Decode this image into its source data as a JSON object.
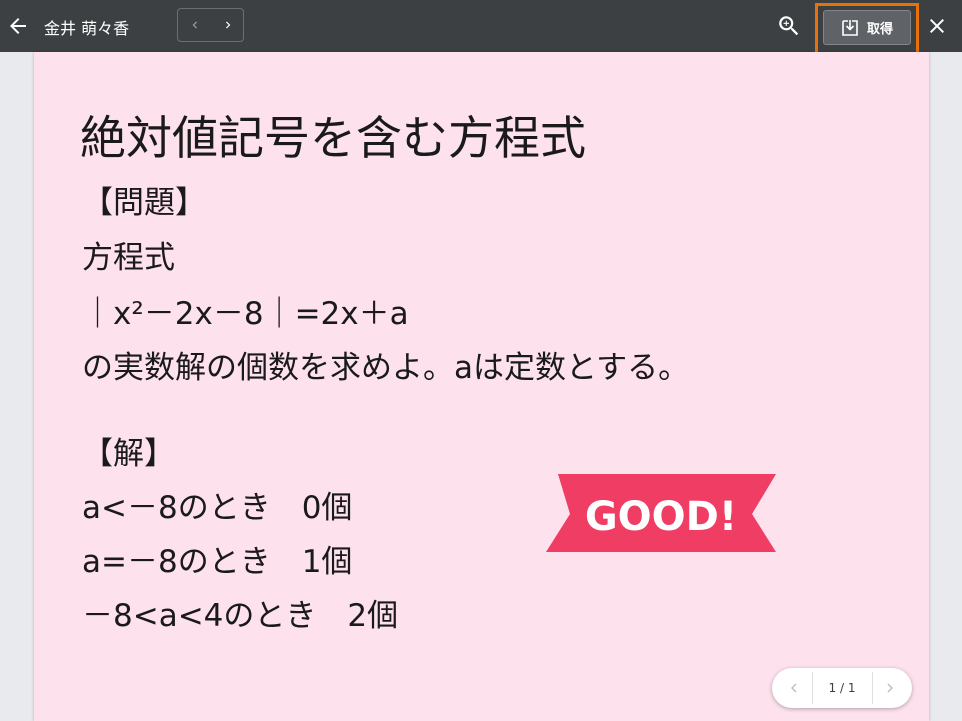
{
  "header": {
    "user_name": "金井 萌々香",
    "get_label": "取得"
  },
  "slide": {
    "title": "絶対値記号を含む方程式",
    "lines": [
      "【問題】",
      "方程式",
      "｜x²－2x－8｜=2x＋a",
      "の実数解の個数を求めよ。aは定数とする。",
      "【解】",
      "a<－8のとき　0個",
      "a=－8のとき　1個",
      "－8<a<4のとき　2個"
    ],
    "stamp_text": "GOOD!"
  },
  "pager": {
    "label": "1 / 1"
  },
  "colors": {
    "topbar": "#3c4043",
    "slide_bg": "#fde2ee",
    "stamp": "#ef3d63",
    "highlight": "#e8710a"
  },
  "icons": [
    "back-arrow-icon",
    "chevron-left-icon",
    "chevron-right-icon",
    "zoom-in-icon",
    "download-icon",
    "close-icon"
  ]
}
